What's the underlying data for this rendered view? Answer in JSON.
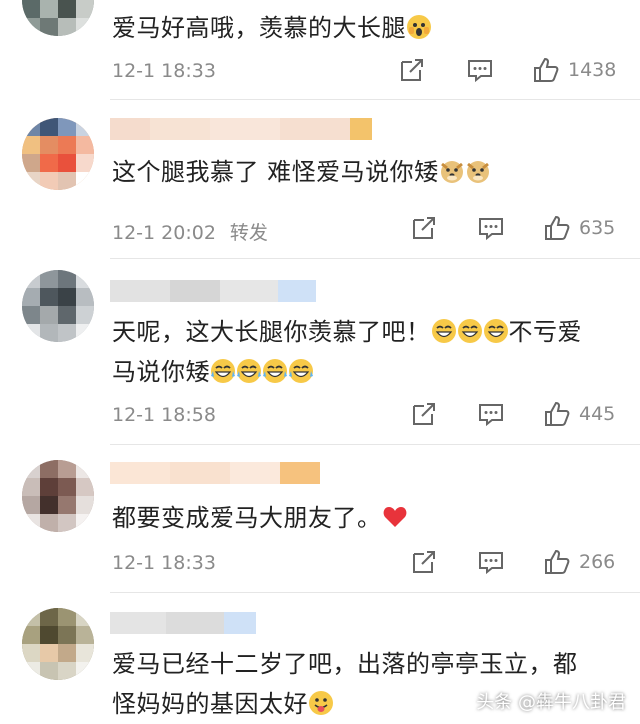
{
  "comments": [
    {
      "text": "爱马好高哦，羡慕的大长腿",
      "date": "12-1 18:33",
      "extra": "",
      "likes": "1438",
      "emoji": [
        "fearful-face"
      ]
    },
    {
      "text": "这个腿我慕了 难怪爱马说你矮",
      "date": "12-1 20:02",
      "extra": "转发",
      "likes": "635",
      "emoji": [
        "doge-face",
        "doge-face"
      ]
    },
    {
      "text_a": "天呢，这大长腿你羡慕了吧！",
      "text_b": "不亏爱",
      "text_c": "马说你矮",
      "date": "12-1 18:58",
      "extra": "",
      "likes": "445",
      "emoji": [
        "grin-face",
        "grin-face",
        "grin-face",
        "tears-of-joy-face"
      ]
    },
    {
      "text": "都要变成爱马大朋友了。",
      "date": "12-1 18:33",
      "extra": "",
      "likes": "266",
      "emoji": [
        "red-heart"
      ]
    },
    {
      "text_a": "爱马已经十二岁了吧，出落的亭亭玉立，都",
      "text_b": "怪妈妈的基因太好",
      "emoji": [
        "tongue-face"
      ]
    }
  ],
  "watermark": "头条 @犇牛八卦君"
}
